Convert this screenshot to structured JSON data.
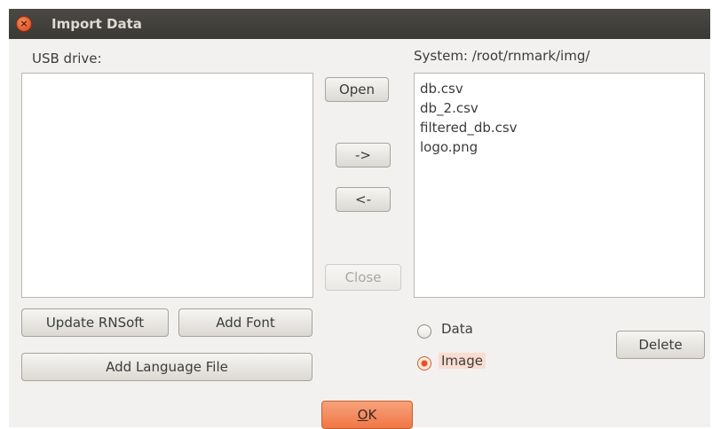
{
  "window": {
    "title": "Import Data",
    "close_icon": "×"
  },
  "left_panel": {
    "label": "USB drive:",
    "items": []
  },
  "right_panel": {
    "label": "System: /root/rnmark/img/",
    "items": [
      "db.csv",
      "db_2.csv",
      "filtered_db.csv",
      "logo.png"
    ]
  },
  "center_buttons": {
    "open": "Open",
    "move_right": "->",
    "move_left": "<-",
    "close": "Close"
  },
  "bottom_left": {
    "update": "Update RNSoft",
    "add_font": "Add Font",
    "add_language": "Add Language File"
  },
  "type_options": {
    "data": "Data",
    "image": "Image",
    "selected": "Image"
  },
  "actions": {
    "delete": "Delete",
    "ok_mnemonic": "O",
    "ok_rest": "K"
  },
  "colors": {
    "accent": "#f07746",
    "titlebar": "#3c3b37"
  }
}
